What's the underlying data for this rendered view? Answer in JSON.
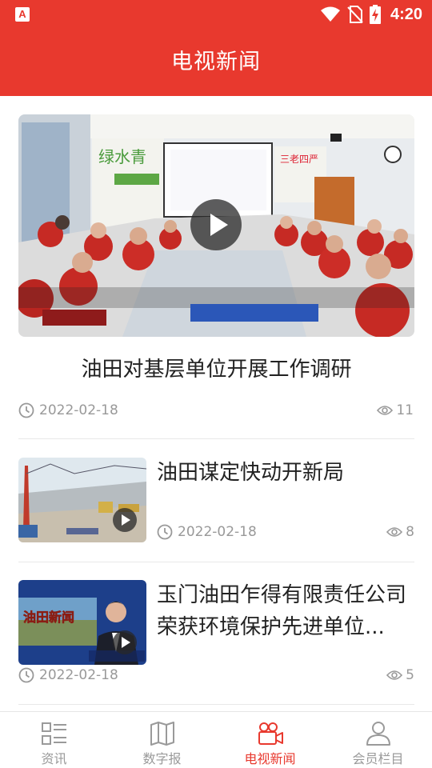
{
  "status_bar": {
    "time": "4:20",
    "app_badge": "A"
  },
  "header": {
    "title": "电视新闻"
  },
  "featured": {
    "title": "油田对基层单位开展工作调研",
    "date": "2022-02-18",
    "views": "11"
  },
  "items": [
    {
      "title": "油田谋定快动开新局",
      "date": "2022-02-18",
      "views": "8"
    },
    {
      "title": "玉门油田乍得有限责任公司荣获环境保护先进单位...",
      "date": "2022-02-18",
      "views": "5"
    }
  ],
  "tabs": [
    {
      "label": "资讯",
      "icon": "list-icon"
    },
    {
      "label": "数字报",
      "icon": "map-icon"
    },
    {
      "label": "电视新闻",
      "icon": "video-camera-icon"
    },
    {
      "label": "会员栏目",
      "icon": "user-icon"
    }
  ],
  "active_tab": "电视新闻",
  "colors": {
    "brand": "#e8392e",
    "muted": "#999999",
    "text": "#222222"
  }
}
